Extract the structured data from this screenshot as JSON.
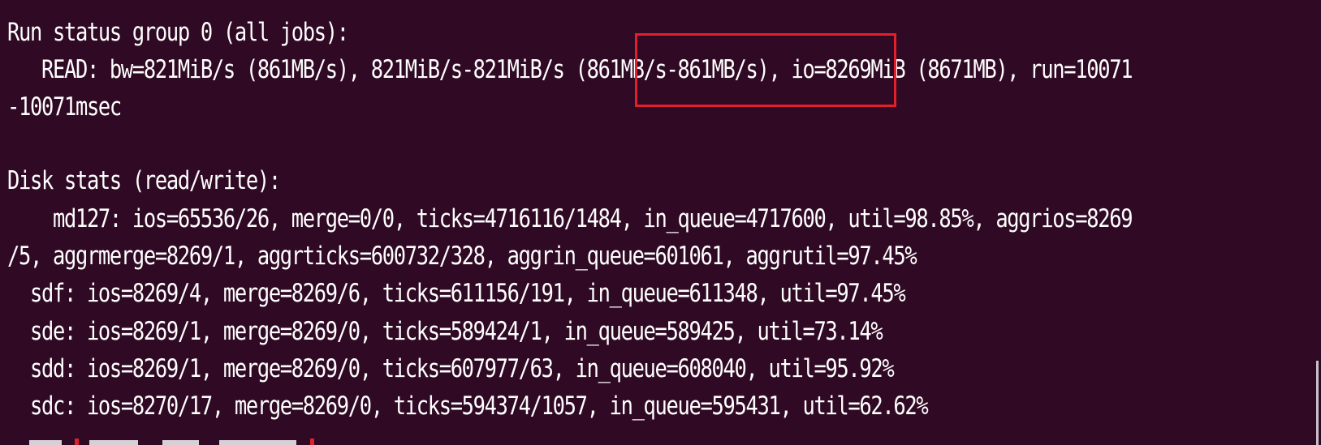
{
  "terminal": {
    "lines": [
      "Run status group 0 (all jobs):",
      "   READ: bw=821MiB/s (861MB/s), 821MiB/s-821MiB/s (861MB/s-861MB/s), io=8269MiB (8671MB), run=10071",
      "-10071msec",
      "Disk stats (read/write):",
      "    md127: ios=65536/26, merge=0/0, ticks=4716116/1484, in_queue=4717600, util=98.85%, aggrios=8269",
      "/5, aggrmerge=8269/1, aggrticks=600732/328, aggrin_queue=601061, aggrutil=97.45%",
      "  sdf: ios=8269/4, merge=8269/6, ticks=611156/191, in_queue=611348, util=97.45%",
      "  sde: ios=8269/1, merge=8269/0, ticks=589424/1, in_queue=589425, util=73.14%",
      "  sdd: ios=8269/1, merge=8269/0, ticks=607977/63, in_queue=608040, util=95.92%",
      "  sdc: ios=8270/17, merge=8269/0, ticks=594374/1057, in_queue=595431, util=62.62%"
    ]
  },
  "colors": {
    "background": "#300a24",
    "text": "#ffffff",
    "highlight": "#e1202b"
  }
}
